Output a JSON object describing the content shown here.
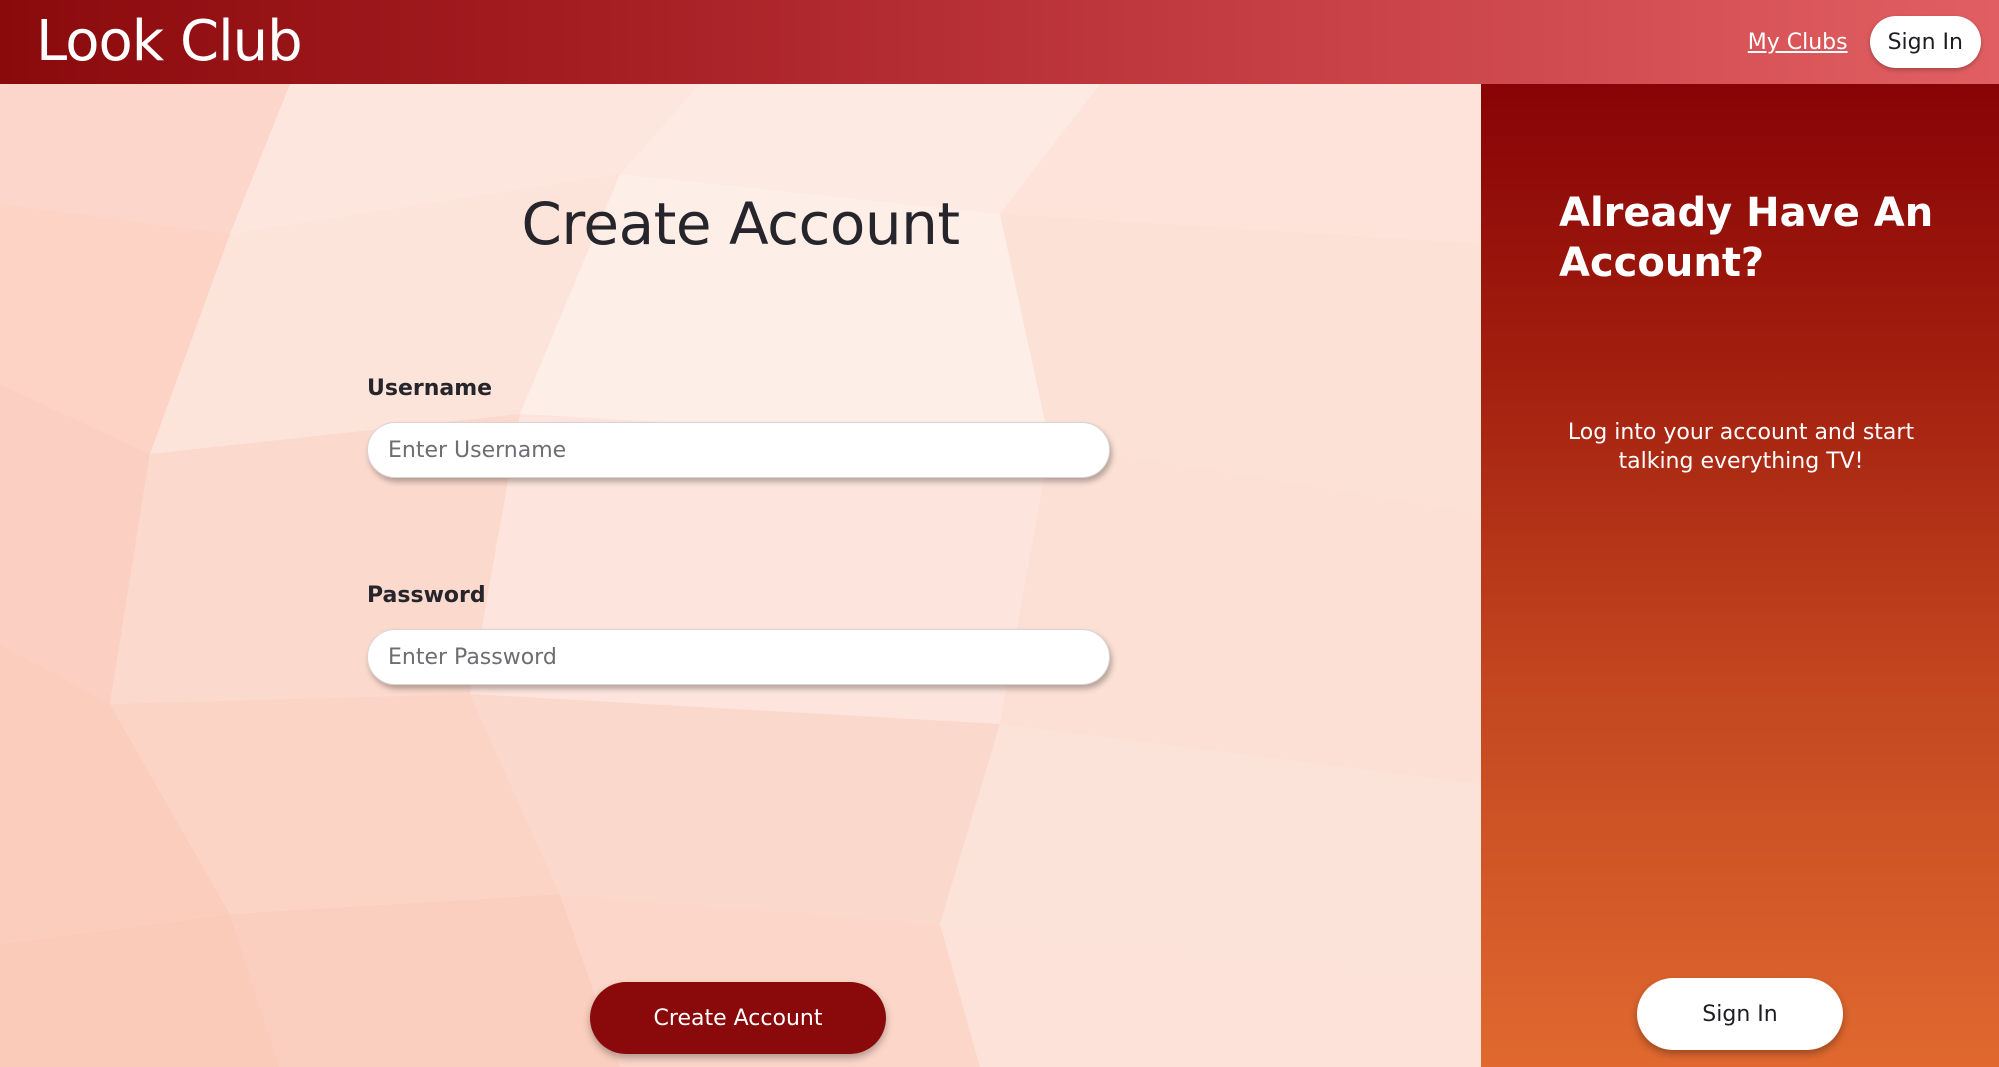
{
  "header": {
    "brand": "Look Club",
    "my_clubs_link": "My Clubs",
    "sign_in_button": "Sign In"
  },
  "form": {
    "title": "Create Account",
    "username": {
      "label": "Username",
      "placeholder": "Enter Username",
      "value": ""
    },
    "password": {
      "label": "Password",
      "placeholder": "Enter Password",
      "value": ""
    },
    "submit_label": "Create Account"
  },
  "side_panel": {
    "title": "Already Have An Account?",
    "text": "Log into your account and start talking everything TV!",
    "sign_in_button": "Sign In"
  },
  "colors": {
    "brand_dark_red": "#8a0a0c",
    "header_gradient_end": "#e15f62",
    "panel_gradient_top": "#880306",
    "panel_gradient_bottom": "#e0692f",
    "page_background": "#fbe1d8",
    "text_dark": "#26252b"
  }
}
